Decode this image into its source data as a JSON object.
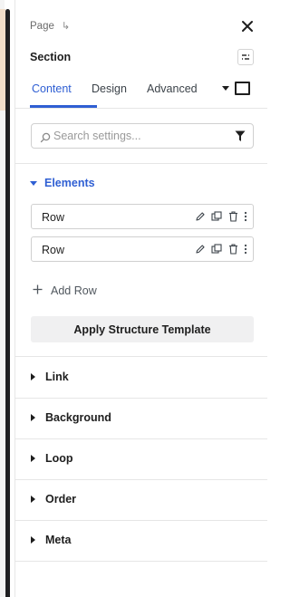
{
  "breadcrumb": {
    "page": "Page",
    "arrow": "↳"
  },
  "header": {
    "title": "Section"
  },
  "tabs": [
    {
      "label": "Content",
      "active": true
    },
    {
      "label": "Design",
      "active": false
    },
    {
      "label": "Advanced",
      "active": false
    }
  ],
  "search": {
    "placeholder": "Search settings...",
    "value": ""
  },
  "elements": {
    "title": "Elements",
    "items": [
      {
        "label": "Row"
      },
      {
        "label": "Row"
      }
    ],
    "add_label": "Add Row",
    "apply_label": "Apply Structure Template"
  },
  "sections": [
    {
      "label": "Link"
    },
    {
      "label": "Background"
    },
    {
      "label": "Loop"
    },
    {
      "label": "Order"
    },
    {
      "label": "Meta"
    }
  ],
  "colors": {
    "accent": "#2f5fd3",
    "text": "#1e1e1e",
    "border": "#d0d0d0",
    "button_bg": "#f0f0f1"
  },
  "icons": {
    "close": "close-icon",
    "structure": "structure-icon",
    "search": "search-icon",
    "filter": "filter-icon",
    "edit": "pencil-icon",
    "duplicate": "duplicate-icon",
    "delete": "trash-icon",
    "more": "more-vertical-icon",
    "add": "plus-icon"
  }
}
